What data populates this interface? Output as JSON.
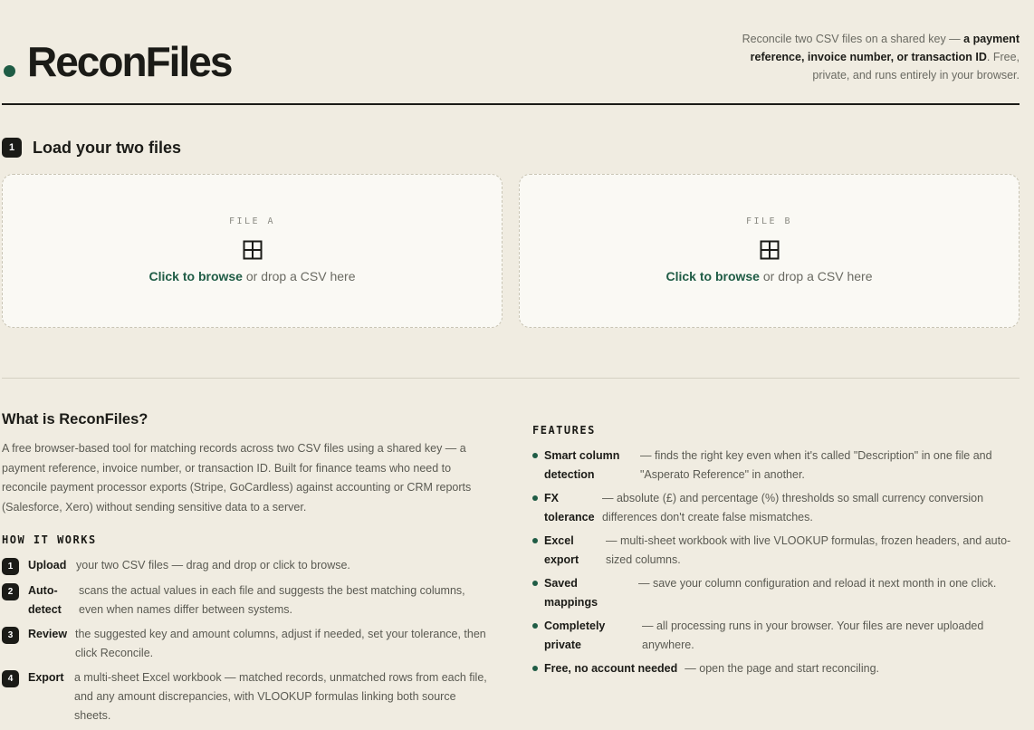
{
  "header": {
    "brand": "ReconFiles",
    "tagline_pre": "Reconcile two CSV files on a shared key — ",
    "tagline_bold": "a payment reference, invoice number, or transaction ID",
    "tagline_post": ". Free, private, and runs entirely in your browser."
  },
  "load": {
    "step_number": "1",
    "title": "Load your two files",
    "file_a": {
      "label": "FILE A",
      "browse": "Click to browse",
      "hint": " or drop a CSV here"
    },
    "file_b": {
      "label": "FILE B",
      "browse": "Click to browse",
      "hint": " or drop a CSV here"
    }
  },
  "about": {
    "title": "What is ReconFiles?",
    "body": "A free browser-based tool for matching records across two CSV files using a shared key — a payment reference, invoice number, or transaction ID. Built for finance teams who need to reconcile payment processor exports (Stripe, GoCardless) against accounting or CRM reports (Salesforce, Xero) without sending sensitive data to a server."
  },
  "how": {
    "heading": "HOW IT WORKS",
    "steps": [
      {
        "num": "1",
        "key": "Upload",
        "desc": "your two CSV files — drag and drop or click to browse."
      },
      {
        "num": "2",
        "key": "Auto-detect",
        "desc": "scans the actual values in each file and suggests the best matching columns, even when names differ between systems."
      },
      {
        "num": "3",
        "key": "Review",
        "desc": "the suggested key and amount columns, adjust if needed, set your tolerance, then click Reconcile."
      },
      {
        "num": "4",
        "key": "Export",
        "desc": "a multi-sheet Excel workbook — matched records, unmatched rows from each file, and any amount discrepancies, with VLOOKUP formulas linking both source sheets."
      }
    ]
  },
  "features": {
    "heading": "FEATURES",
    "items": [
      {
        "key": "Smart column detection",
        "desc": "— finds the right key even when it's called \"Description\" in one file and \"Asperato Reference\" in another."
      },
      {
        "key": "FX tolerance",
        "desc": "— absolute (£) and percentage (%) thresholds so small currency conversion differences don't create false mismatches."
      },
      {
        "key": "Excel export",
        "desc": "— multi-sheet workbook with live VLOOKUP formulas, frozen headers, and auto-sized columns."
      },
      {
        "key": "Saved mappings",
        "desc": "— save your column configuration and reload it next month in one click."
      },
      {
        "key": "Completely private",
        "desc": "— all processing runs in your browser. Your files are never uploaded anywhere."
      },
      {
        "key": "Free, no account needed",
        "desc": "— open the page and start reconciling."
      }
    ]
  }
}
